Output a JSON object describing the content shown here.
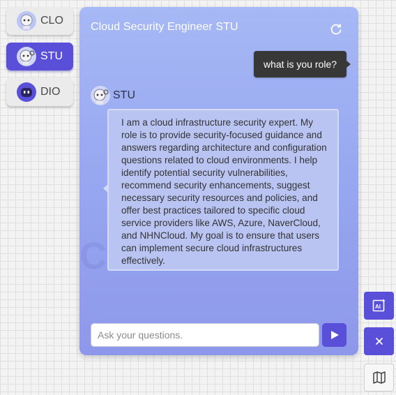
{
  "agents": [
    {
      "label": "CLO",
      "icon": "robot-avatar-icon",
      "active": false
    },
    {
      "label": "STU",
      "icon": "robot-avatar-icon",
      "active": true
    },
    {
      "label": "DIO",
      "icon": "robot-avatar-icon",
      "active": false
    }
  ],
  "chat": {
    "title": "Cloud Security Engineer STU",
    "watermark": "CloudStudio",
    "user_message": "what is you role?",
    "bot_name": "STU",
    "bot_message": "I am a cloud infrastructure security expert. My role is to provide security-focused guidance and answers regarding architecture and configuration questions related to cloud environments. I help identify potential security vulnerabilities, recommend security enhancements, suggest necessary security resources and policies, and offer best practices tailored to specific cloud service providers like AWS, Azure, NaverCloud, and NHNCloud. My goal is to ensure that users can implement secure cloud infrastructures effectively.",
    "input_placeholder": "Ask your questions.",
    "input_value": ""
  },
  "side_buttons": [
    {
      "icon": "ai-icon"
    },
    {
      "icon": "close-icon"
    },
    {
      "icon": "map-icon"
    }
  ],
  "colors": {
    "accent": "#5a4fd9",
    "panel_top": "#a6b8f5",
    "panel_bottom": "#8e98ea",
    "user_bubble": "#383838"
  }
}
